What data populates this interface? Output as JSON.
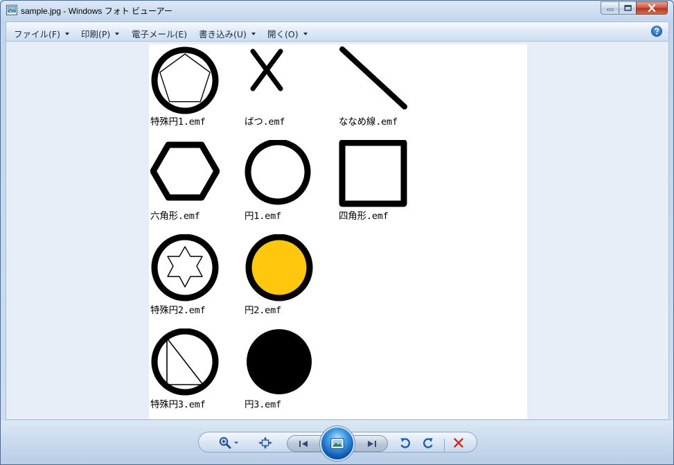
{
  "window": {
    "title": "sample.jpg - Windows フォト ビューアー",
    "icons": [
      "app-icon",
      "minimize-icon",
      "maximize-icon",
      "close-icon"
    ]
  },
  "menu": {
    "items": [
      {
        "label": "ファイル(F)",
        "has_dropdown": true
      },
      {
        "label": "印刷(P)",
        "has_dropdown": true
      },
      {
        "label": "電子メール(E)",
        "has_dropdown": false
      },
      {
        "label": "書き込み(U)",
        "has_dropdown": true
      },
      {
        "label": "開く(O)",
        "has_dropdown": true
      }
    ],
    "help_icon": "help-icon"
  },
  "image": {
    "files": [
      {
        "caption": "特殊円1.emf",
        "shape": "circle-with-pentagon"
      },
      {
        "caption": "ばつ.emf",
        "shape": "x-cross"
      },
      {
        "caption": "ななめ線.emf",
        "shape": "diagonal-line"
      },
      {
        "caption": "六角形.emf",
        "shape": "hexagon"
      },
      {
        "caption": "円1.emf",
        "shape": "circle-outline"
      },
      {
        "caption": "四角形.emf",
        "shape": "square-outline"
      },
      {
        "caption": "特殊円2.emf",
        "shape": "circle-with-star"
      },
      {
        "caption": "円2.emf",
        "shape": "circle-yellow-fill"
      },
      {
        "caption": "特殊円3.emf",
        "shape": "circle-with-triangle"
      },
      {
        "caption": "円3.emf",
        "shape": "circle-black-fill"
      }
    ],
    "colors": {
      "stroke": "#000000",
      "yellow": "#ffc70d",
      "canvas": "#ffffff"
    }
  },
  "toolbar": {
    "icons": [
      "zoom-icon",
      "zoom-dropdown-icon",
      "actual-size-icon",
      "previous-icon",
      "slideshow-icon",
      "next-icon",
      "rotate-counterclockwise-icon",
      "rotate-clockwise-icon",
      "delete-icon"
    ]
  }
}
